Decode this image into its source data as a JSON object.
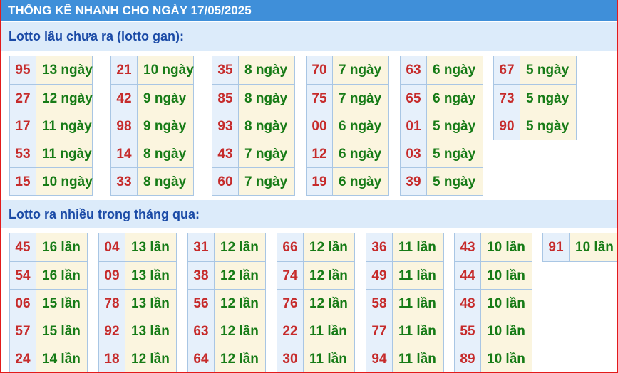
{
  "header": {
    "title": "THỐNG KÊ NHANH CHO NGÀY 17/05/2025"
  },
  "gan": {
    "title": "Lotto lâu chưa ra (lotto gan):",
    "columns": [
      [
        {
          "num": "95",
          "count": "13 ngày"
        },
        {
          "num": "27",
          "count": "12 ngày"
        },
        {
          "num": "17",
          "count": "11 ngày"
        },
        {
          "num": "53",
          "count": "11 ngày"
        },
        {
          "num": "15",
          "count": "10 ngày"
        }
      ],
      [
        {
          "num": "21",
          "count": "10 ngày"
        },
        {
          "num": "42",
          "count": "9 ngày"
        },
        {
          "num": "98",
          "count": "9 ngày"
        },
        {
          "num": "14",
          "count": "8 ngày"
        },
        {
          "num": "33",
          "count": "8 ngày"
        }
      ],
      [
        {
          "num": "35",
          "count": "8 ngày"
        },
        {
          "num": "85",
          "count": "8 ngày"
        },
        {
          "num": "93",
          "count": "8 ngày"
        },
        {
          "num": "43",
          "count": "7 ngày"
        },
        {
          "num": "60",
          "count": "7 ngày"
        }
      ],
      [
        {
          "num": "70",
          "count": "7 ngày"
        },
        {
          "num": "75",
          "count": "7 ngày"
        },
        {
          "num": "00",
          "count": "6 ngày"
        },
        {
          "num": "12",
          "count": "6 ngày"
        },
        {
          "num": "19",
          "count": "6 ngày"
        }
      ],
      [
        {
          "num": "63",
          "count": "6 ngày"
        },
        {
          "num": "65",
          "count": "6 ngày"
        },
        {
          "num": "01",
          "count": "5 ngày"
        },
        {
          "num": "03",
          "count": "5 ngày"
        },
        {
          "num": "39",
          "count": "5 ngày"
        }
      ],
      [
        {
          "num": "67",
          "count": "5 ngày"
        },
        {
          "num": "73",
          "count": "5 ngày"
        },
        {
          "num": "90",
          "count": "5 ngày"
        }
      ]
    ]
  },
  "freq": {
    "title": "Lotto ra nhiều trong tháng qua:",
    "columns": [
      [
        {
          "num": "45",
          "count": "16 lần"
        },
        {
          "num": "54",
          "count": "16 lần"
        },
        {
          "num": "06",
          "count": "15 lần"
        },
        {
          "num": "57",
          "count": "15 lần"
        },
        {
          "num": "24",
          "count": "14 lần"
        }
      ],
      [
        {
          "num": "04",
          "count": "13 lần"
        },
        {
          "num": "09",
          "count": "13 lần"
        },
        {
          "num": "78",
          "count": "13 lần"
        },
        {
          "num": "92",
          "count": "13 lần"
        },
        {
          "num": "18",
          "count": "12 lần"
        }
      ],
      [
        {
          "num": "31",
          "count": "12 lần"
        },
        {
          "num": "38",
          "count": "12 lần"
        },
        {
          "num": "56",
          "count": "12 lần"
        },
        {
          "num": "63",
          "count": "12 lần"
        },
        {
          "num": "64",
          "count": "12 lần"
        }
      ],
      [
        {
          "num": "66",
          "count": "12 lần"
        },
        {
          "num": "74",
          "count": "12 lần"
        },
        {
          "num": "76",
          "count": "12 lần"
        },
        {
          "num": "22",
          "count": "11 lần"
        },
        {
          "num": "30",
          "count": "11 lần"
        }
      ],
      [
        {
          "num": "36",
          "count": "11 lần"
        },
        {
          "num": "49",
          "count": "11 lần"
        },
        {
          "num": "58",
          "count": "11 lần"
        },
        {
          "num": "77",
          "count": "11 lần"
        },
        {
          "num": "94",
          "count": "11 lần"
        }
      ],
      [
        {
          "num": "43",
          "count": "10 lần"
        },
        {
          "num": "44",
          "count": "10 lần"
        },
        {
          "num": "48",
          "count": "10 lần"
        },
        {
          "num": "55",
          "count": "10 lần"
        },
        {
          "num": "89",
          "count": "10 lần"
        }
      ],
      [
        {
          "num": "91",
          "count": "10 lần"
        }
      ]
    ]
  }
}
